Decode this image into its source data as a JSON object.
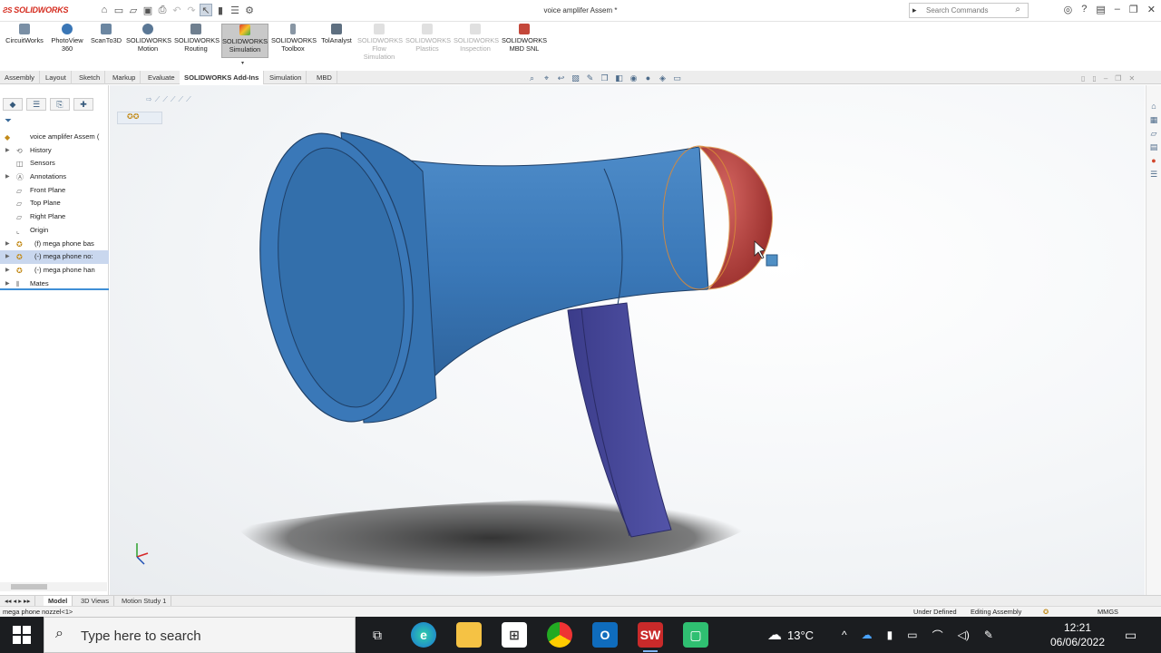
{
  "app": {
    "logo": "SOLIDWORKS",
    "document_title": "voice amplifer Assem *"
  },
  "search": {
    "placeholder": "Search Commands"
  },
  "ribbon": {
    "buttons": [
      {
        "label1": "CircuitWorks",
        "label2": "",
        "label3": "",
        "state": "normal"
      },
      {
        "label1": "PhotoView",
        "label2": "360",
        "label3": "",
        "state": "normal"
      },
      {
        "label1": "ScanTo3D",
        "label2": "",
        "label3": "",
        "state": "normal"
      },
      {
        "label1": "SOLIDWORKS",
        "label2": "Motion",
        "label3": "",
        "state": "normal"
      },
      {
        "label1": "SOLIDWORKS",
        "label2": "Routing",
        "label3": "",
        "state": "normal"
      },
      {
        "label1": "SOLIDWORKS",
        "label2": "Simulation",
        "label3": "",
        "state": "active"
      },
      {
        "label1": "SOLIDWORKS",
        "label2": "Toolbox",
        "label3": "",
        "state": "normal"
      },
      {
        "label1": "TolAnalyst",
        "label2": "",
        "label3": "",
        "state": "normal"
      },
      {
        "label1": "SOLIDWORKS",
        "label2": "Flow",
        "label3": "Simulation",
        "state": "dim"
      },
      {
        "label1": "SOLIDWORKS",
        "label2": "Plastics",
        "label3": "",
        "state": "dim"
      },
      {
        "label1": "SOLIDWORKS",
        "label2": "Inspection",
        "label3": "",
        "state": "dim"
      },
      {
        "label1": "SOLIDWORKS",
        "label2": "MBD SNL",
        "label3": "",
        "state": "normal"
      }
    ]
  },
  "command_tabs": [
    "Assembly",
    "Layout",
    "Sketch",
    "Markup",
    "Evaluate",
    "SOLIDWORKS Add-Ins",
    "Simulation",
    "MBD"
  ],
  "feature_tree": {
    "items": [
      {
        "label": "voice amplifer Assem  (",
        "icon": "assembly-icon"
      },
      {
        "label": "History",
        "icon": "history-icon"
      },
      {
        "label": "Sensors",
        "icon": "sensor-icon"
      },
      {
        "label": "Annotations",
        "icon": "annotation-icon"
      },
      {
        "label": "Front Plane",
        "icon": "plane-icon"
      },
      {
        "label": "Top Plane",
        "icon": "plane-icon"
      },
      {
        "label": "Right Plane",
        "icon": "plane-icon"
      },
      {
        "label": "Origin",
        "icon": "origin-icon"
      },
      {
        "label": "(f) mega phone bas",
        "icon": "part-icon"
      },
      {
        "label": "(-) mega phone no:",
        "icon": "part-icon"
      },
      {
        "label": "(-) mega phone han",
        "icon": "part-icon"
      },
      {
        "label": "Mates",
        "icon": "mates-icon"
      }
    ]
  },
  "bottom_tabs": [
    "Model",
    "3D Views",
    "Motion Study 1"
  ],
  "status": {
    "left": "mega phone nozzel<1>",
    "state": "Under Defined",
    "mode": "Editing Assembly",
    "units": "MMGS"
  },
  "taskbar": {
    "search_text": "Type here to search",
    "weather": "13°C",
    "time": "12:21",
    "date": "06/06/2022"
  },
  "colors": {
    "horn_blue": "#3a78b8",
    "cap_red": "#b5403d",
    "handle_purple": "#46479a",
    "accent": "#d52b1e"
  }
}
